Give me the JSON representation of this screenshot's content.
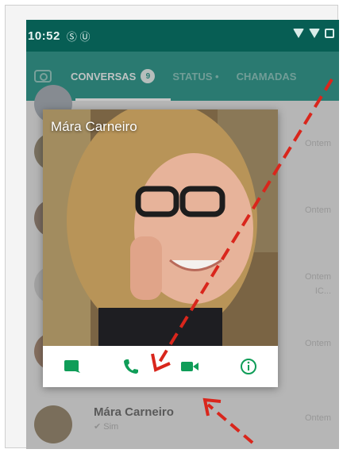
{
  "status_bar": {
    "time": "10:52",
    "notification_icons": "Ⓢ Ⓤ"
  },
  "tabs": {
    "camera_icon": "camera-icon",
    "items": [
      {
        "label": "CONVERSAS",
        "badge": "9"
      },
      {
        "label": "STATUS •"
      },
      {
        "label": "CHAMADAS"
      }
    ]
  },
  "chat_list": {
    "times": [
      "Ontem",
      "Ontem",
      "Ontem",
      "Ontem",
      "Ontem"
    ],
    "snippet": "IC...",
    "bottom_contact": {
      "name": "Mára Carneiro",
      "message": "✔ Sim"
    }
  },
  "profile_popup": {
    "contact_name": "Mára Carneiro",
    "actions": [
      {
        "name": "message-action",
        "icon": "chat-icon"
      },
      {
        "name": "call-action",
        "icon": "phone-icon"
      },
      {
        "name": "video-action",
        "icon": "video-icon"
      },
      {
        "name": "info-action",
        "icon": "info-icon"
      }
    ]
  },
  "colors": {
    "status_bar": "#075e54",
    "tab_bar": "#128c7e",
    "accent": "#0f9d58",
    "annotation_arrow": "#d9261c"
  }
}
